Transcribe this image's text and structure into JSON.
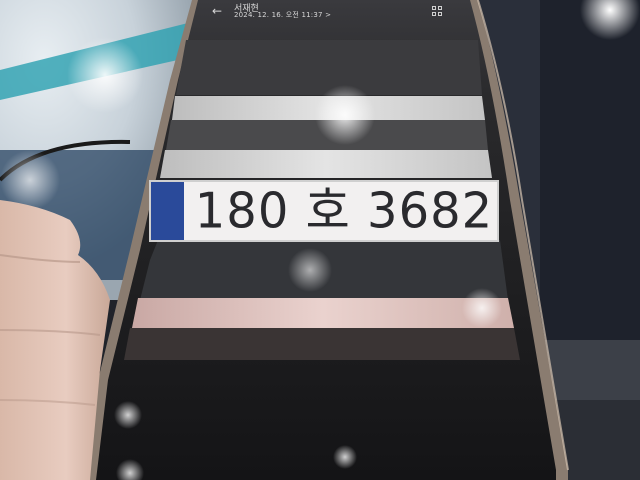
{
  "header": {
    "back_icon": "back-arrow-icon",
    "album_name": "서재현",
    "datetime": "2024. 12. 16. 오전 11:37 >",
    "grid_icon": "grid-view-icon"
  },
  "plate": {
    "text": "180 호 3682"
  },
  "colors": {
    "plate_white": "#f2f0f0",
    "plate_blue_band": "#2a4a9a",
    "screen_dark": "#121214"
  }
}
